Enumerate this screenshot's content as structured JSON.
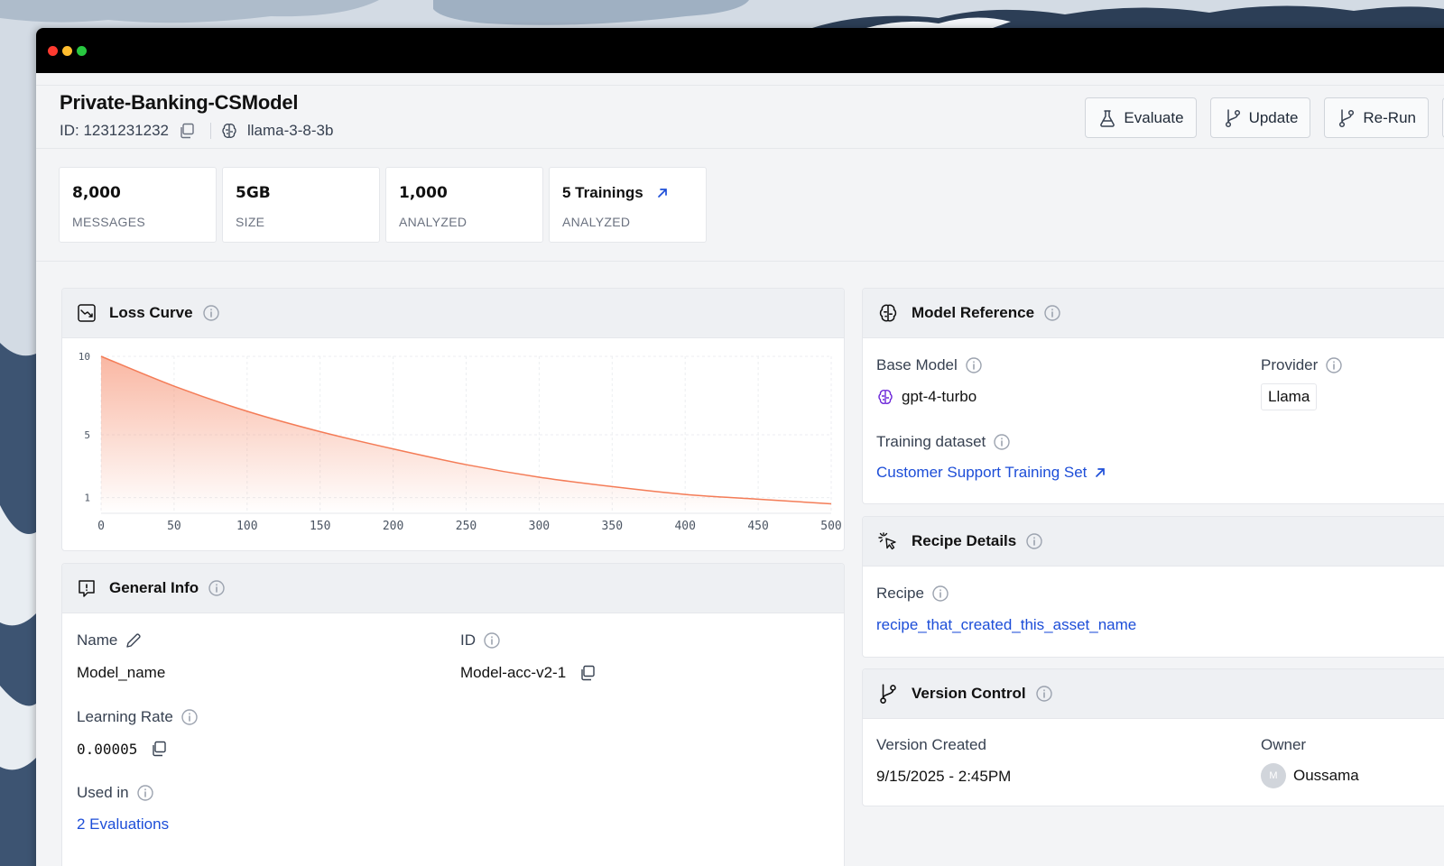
{
  "header": {
    "title": "Private-Banking-CSModel",
    "id_text": "ID: 1231231232",
    "model": "llama-3-8-3b"
  },
  "actions": [
    {
      "label": "Evaluate",
      "icon": "flask-icon"
    },
    {
      "label": "Update",
      "icon": "git-branch-icon"
    },
    {
      "label": "Re-Run",
      "icon": "git-branch-icon"
    }
  ],
  "stats": [
    {
      "value": "8,000",
      "label": "MESSAGES"
    },
    {
      "value": "5GB",
      "label": "SIZE"
    },
    {
      "value": "1,000",
      "label": "ANALYZED"
    },
    {
      "value": "5 Trainings",
      "label": "ANALYZED"
    }
  ],
  "loss_curve": {
    "title": "Loss Curve"
  },
  "chart_data": {
    "type": "area",
    "title": "",
    "xlabel": "",
    "ylabel": "",
    "x_ticks": [
      "0",
      "50",
      "100",
      "150",
      "200",
      "250",
      "300",
      "350",
      "400",
      "450",
      "500"
    ],
    "y_ticks": [
      "10",
      "5",
      "1"
    ],
    "xlim": [
      0,
      500
    ],
    "ylim": [
      0,
      10
    ],
    "grid": true,
    "series": [
      {
        "color": "#f47c57",
        "x": [
          0,
          50,
          100,
          150,
          200,
          250,
          300,
          350,
          400,
          450,
          500
        ],
        "y": [
          10.0,
          8.1,
          6.5,
          5.2,
          4.1,
          3.1,
          2.3,
          1.7,
          1.2,
          0.9,
          0.6
        ]
      }
    ]
  },
  "general_info": {
    "title": "General Info",
    "name_label": "Name",
    "name_value": "Model_name",
    "id_label": "ID",
    "id_value": "Model-acc-v2-1",
    "lr_label": "Learning Rate",
    "lr_value": "0.00005",
    "used_label": "Used in",
    "used_value": "2 Evaluations"
  },
  "model_reference": {
    "title": "Model Reference",
    "base_label": "Base Model",
    "base_value": "gpt-4-turbo",
    "provider_label": "Provider",
    "provider_value": "Llama",
    "dataset_label": "Training dataset",
    "dataset_value": "Customer Support Training Set"
  },
  "recipe": {
    "title": "Recipe Details",
    "recipe_label": "Recipe",
    "recipe_value": "recipe_that_created_this_asset_name"
  },
  "version": {
    "title": "Version Control",
    "created_label": "Version Created",
    "created_value": "9/15/2025 - 2:45PM",
    "owner_label": "Owner",
    "owner_initial": "M",
    "owner_value": "Oussama"
  },
  "colors": {
    "accent": "#1d4ed8",
    "chart_line": "#f47c57",
    "titlebar": "#000000"
  }
}
